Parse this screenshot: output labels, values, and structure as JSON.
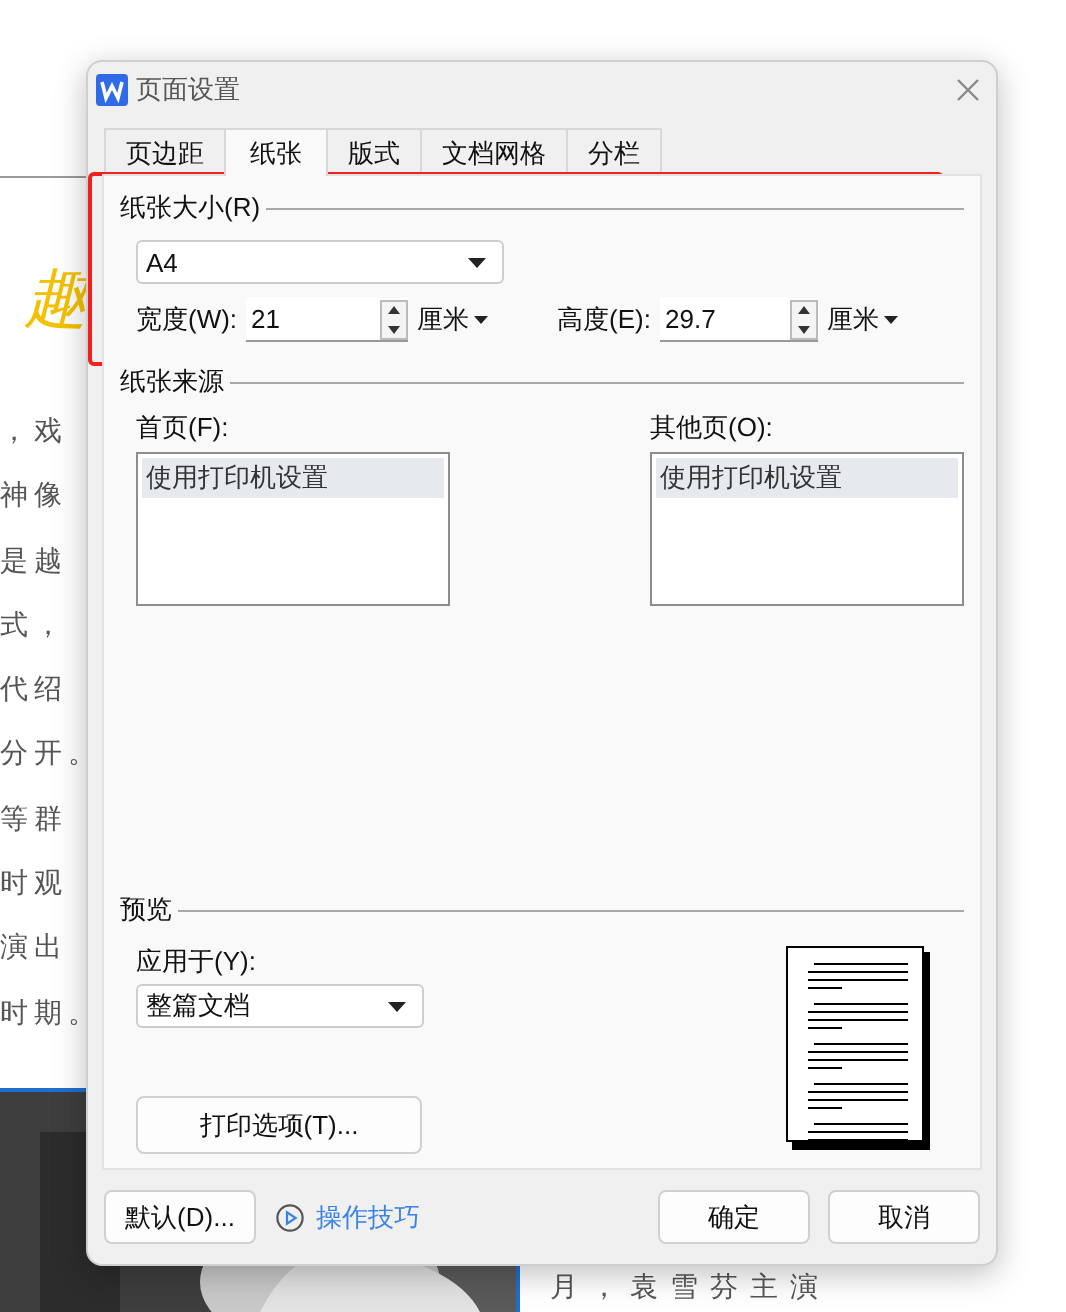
{
  "background_document": {
    "heading_fragment": "趣",
    "text_fragments": [
      "，戏",
      "神像",
      "是越",
      "式，",
      "代绍",
      "分开。",
      "等群",
      "时观",
      "演出",
      "时期。"
    ],
    "bottom_text": "月，袁雪芬主演"
  },
  "dialog": {
    "title": "页面设置",
    "tabs": [
      {
        "label": "页边距",
        "selected": false
      },
      {
        "label": "纸张",
        "selected": true
      },
      {
        "label": "版式",
        "selected": false
      },
      {
        "label": "文档网格",
        "selected": false
      },
      {
        "label": "分栏",
        "selected": false
      }
    ],
    "paper_size": {
      "legend": "纸张大小(R)",
      "size": "A4",
      "width": {
        "label": "宽度(W):",
        "value": "21",
        "unit": "厘米"
      },
      "height": {
        "label": "高度(E):",
        "value": "29.7",
        "unit": "厘米"
      }
    },
    "paper_source": {
      "legend": "纸张来源",
      "first_page": {
        "label": "首页(F):",
        "items": [
          {
            "text": "使用打印机设置",
            "selected": true
          }
        ]
      },
      "other_pages": {
        "label": "其他页(O):",
        "items": [
          {
            "text": "使用打印机设置",
            "selected": true
          }
        ]
      }
    },
    "preview": {
      "legend": "预览",
      "apply_to": {
        "label": "应用于(Y):",
        "value": "整篇文档"
      }
    },
    "print_options_button": "打印选项(T)...",
    "footer": {
      "default_button": "默认(D)...",
      "tips_link": "操作技巧",
      "ok_button": "确定",
      "cancel_button": "取消"
    }
  }
}
